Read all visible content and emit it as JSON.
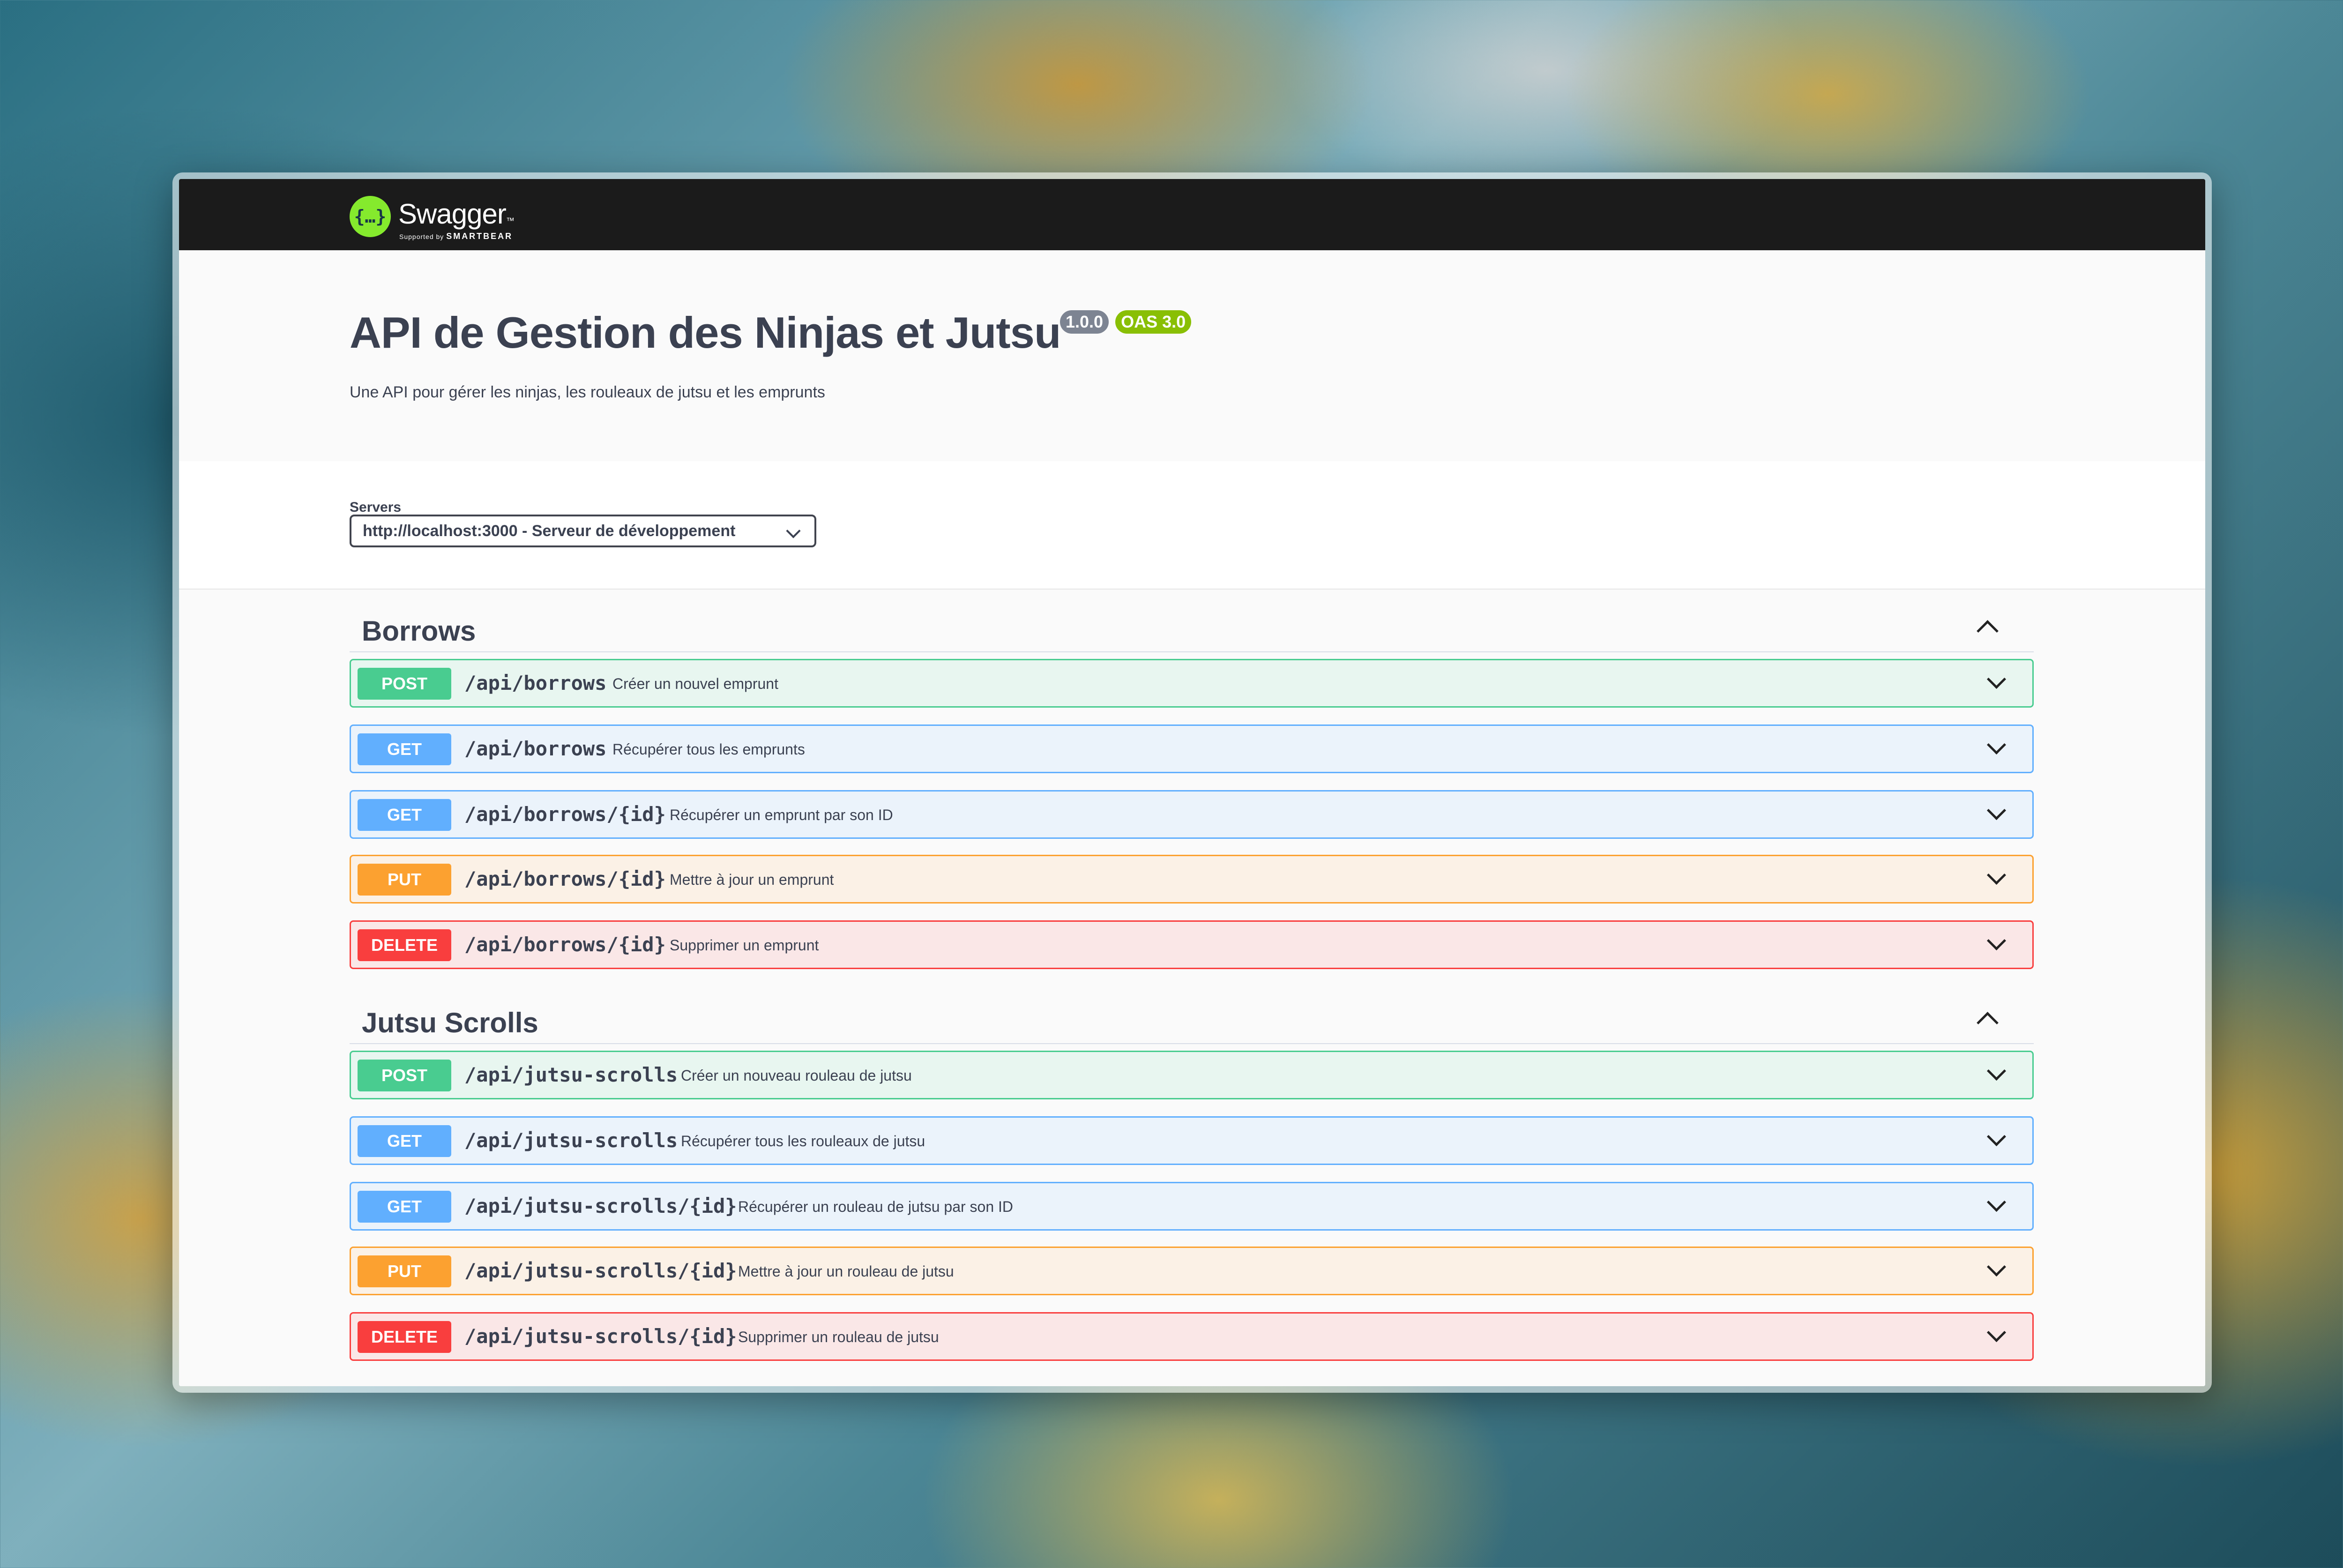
{
  "topbar": {
    "logo_mark": "{…}",
    "brand": "Swagger",
    "brand_tm": "™",
    "supported_by": "Supported by",
    "company": "SMARTBEAR"
  },
  "info": {
    "title": "API de Gestion des Ninjas et Jutsu",
    "version": "1.0.0",
    "oas": "OAS 3.0",
    "description": "Une API pour gérer les ninjas, les rouleaux de jutsu et les emprunts"
  },
  "servers": {
    "label": "Servers",
    "selected": "http://localhost:3000 - Serveur de développement"
  },
  "tags": [
    {
      "name": "Borrows",
      "operations": [
        {
          "method": "POST",
          "path": "/api/borrows",
          "summary": "Créer un nouvel emprunt"
        },
        {
          "method": "GET",
          "path": "/api/borrows",
          "summary": "Récupérer tous les emprunts"
        },
        {
          "method": "GET",
          "path": "/api/borrows/{id}",
          "summary": "Récupérer un emprunt par son ID"
        },
        {
          "method": "PUT",
          "path": "/api/borrows/{id}",
          "summary": "Mettre à jour un emprunt"
        },
        {
          "method": "DELETE",
          "path": "/api/borrows/{id}",
          "summary": "Supprimer un emprunt"
        }
      ]
    },
    {
      "name": "Jutsu Scrolls",
      "operations": [
        {
          "method": "POST",
          "path": "/api/jutsu-scrolls",
          "summary": "Créer un nouveau rouleau de jutsu"
        },
        {
          "method": "GET",
          "path": "/api/jutsu-scrolls",
          "summary": "Récupérer tous les rouleaux de jutsu"
        },
        {
          "method": "GET",
          "path": "/api/jutsu-scrolls/{id}",
          "summary": "Récupérer un rouleau de jutsu par son ID"
        },
        {
          "method": "PUT",
          "path": "/api/jutsu-scrolls/{id}",
          "summary": "Mettre à jour un rouleau de jutsu"
        },
        {
          "method": "DELETE",
          "path": "/api/jutsu-scrolls/{id}",
          "summary": "Supprimer un rouleau de jutsu"
        }
      ]
    }
  ],
  "colors": {
    "post": "#49cc90",
    "get": "#61affe",
    "put": "#fca130",
    "delete": "#f93e3e",
    "topbar": "#1b1b1b",
    "brand_green": "#85ea2d"
  }
}
